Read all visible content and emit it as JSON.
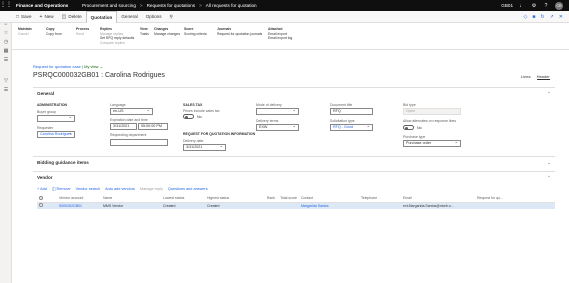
{
  "topbar": {
    "app_title": "Finance and Operations",
    "breadcrumb": [
      "Procurement and sourcing",
      "Requests for quotations",
      "All requests for quotation"
    ],
    "company": "GB01"
  },
  "actionbar": {
    "save": "Save",
    "new": "New",
    "delete": "Delete",
    "tabs": [
      "Quotation",
      "General",
      "Options"
    ]
  },
  "ribbon": {
    "groups": [
      {
        "title": "Maintain",
        "items": [
          "Cancel"
        ]
      },
      {
        "title": "Copy",
        "items": [
          "Copy from"
        ]
      },
      {
        "title": "Process",
        "items": [
          "Send"
        ]
      },
      {
        "title": "Replies",
        "items": [
          "Manage replies",
          "Set RFQ reply defaults",
          "Compare replies"
        ]
      },
      {
        "title": "View",
        "items": [
          "Totals"
        ]
      },
      {
        "title": "Changes",
        "items": [
          "Manage changes"
        ]
      },
      {
        "title": "Score",
        "items": [
          "Scoring criteria"
        ]
      },
      {
        "title": "Journals",
        "items": [
          "Request for quotation journals"
        ]
      },
      {
        "title": "Attached",
        "items": [
          "Email export",
          "Email export log"
        ]
      }
    ]
  },
  "context": {
    "link": "Request for quotation case",
    "separator": "|",
    "view": "My view"
  },
  "page_title": "PSRQC000032GB01 : Carolina Rodrigues",
  "view_switch": {
    "lines": "Lines",
    "header": "Header"
  },
  "general": {
    "title": "General",
    "administration": "ADMINISTRATION",
    "buyer_group_label": "Buyer group",
    "buyer_group_value": "",
    "requester_label": "Requester",
    "requester_value": "Carolina Rodrigues",
    "language_label": "Language",
    "language_value": "en-US",
    "expiration_label": "Expiration date and time",
    "expiration_date": "3/31/2021",
    "expiration_time": "05:00:00 PM",
    "requesting_dept_label": "Requesting department",
    "requesting_dept_value": "",
    "sales_tax": "SALES TAX",
    "prices_include_tax_label": "Prices include sales tax",
    "prices_include_tax_value": "No",
    "rfq_info": "REQUEST FOR QUOTATION INFORMATION",
    "delivery_date_label": "Delivery date",
    "delivery_date_value": "3/31/2021",
    "mode_delivery_label": "Mode of delivery",
    "mode_delivery_value": "",
    "delivery_terms_label": "Delivery terms",
    "delivery_terms_value": "EXW",
    "doc_title_label": "Document title",
    "doc_title_value": "RFQ",
    "solicitation_label": "Solicitation type",
    "solicitation_value": "RFQ - Good",
    "bid_type_label": "Bid type",
    "bid_type_value": "Open",
    "allow_alt_label": "Allow alternates on response lines",
    "allow_alt_value": "No",
    "purchase_type_label": "Purchase type",
    "purchase_type_value": "Purchase order"
  },
  "bidding": {
    "title": "Bidding guidance items"
  },
  "vendor": {
    "title": "Vendor",
    "toolbar": [
      "Add",
      "Remove",
      "Vendor search",
      "Auto add vendors",
      "Manage reply",
      "Questions and answers"
    ],
    "columns": [
      "Vendor account",
      "Name",
      "Lowest status",
      "Highest status",
      "Rank",
      "Total score",
      "Contact",
      "Telephone",
      "Email",
      "Request for qu..."
    ],
    "rows": [
      {
        "account": "S000262GB01",
        "name": "MMS Vendor",
        "lowest": "Created",
        "highest": "Created",
        "rank": "",
        "total": "",
        "contact": "Margarida Santos",
        "phone": "",
        "email": "ext.Margarida.Santos@ntorb.o...",
        "rfq": ""
      }
    ]
  },
  "colors": {
    "accent": "#2266e3",
    "topbar": "#0f0f0f",
    "selected_row": "#dde8f7"
  }
}
